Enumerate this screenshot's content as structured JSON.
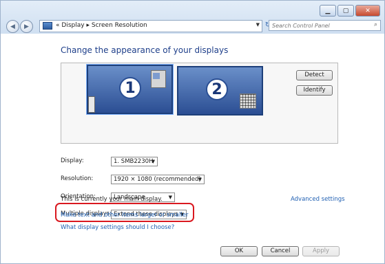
{
  "nav": {
    "breadcrumb_prefix": "«",
    "breadcrumb_1": "Display",
    "breadcrumb_sep": "▸",
    "breadcrumb_2": "Screen Resolution",
    "search_placeholder": "Search Control Panel"
  },
  "heading": "Change the appearance of your displays",
  "monitors": [
    {
      "number": "1"
    },
    {
      "number": "2"
    }
  ],
  "buttons": {
    "detect": "Detect",
    "identify": "Identify",
    "ok": "OK",
    "cancel": "Cancel",
    "apply": "Apply"
  },
  "fields": {
    "display_label": "Display:",
    "display_value": "1. SMB2230H",
    "resolution_label": "Resolution:",
    "resolution_value": "1920 × 1080 (recommended)",
    "orientation_label": "Orientation:",
    "orientation_value": "Landscape",
    "multiple_label": "Multiple displays:",
    "multiple_value": "Extend these displays"
  },
  "main_display_text": "This is currently your main display.",
  "links": {
    "advanced": "Advanced settings",
    "text_size": "Make text and other items larger or smaller",
    "which_settings": "What display settings should I choose?"
  },
  "colors": {
    "heading": "#1e3f8a",
    "link": "#1f5fb2",
    "highlight": "#d9181f"
  }
}
